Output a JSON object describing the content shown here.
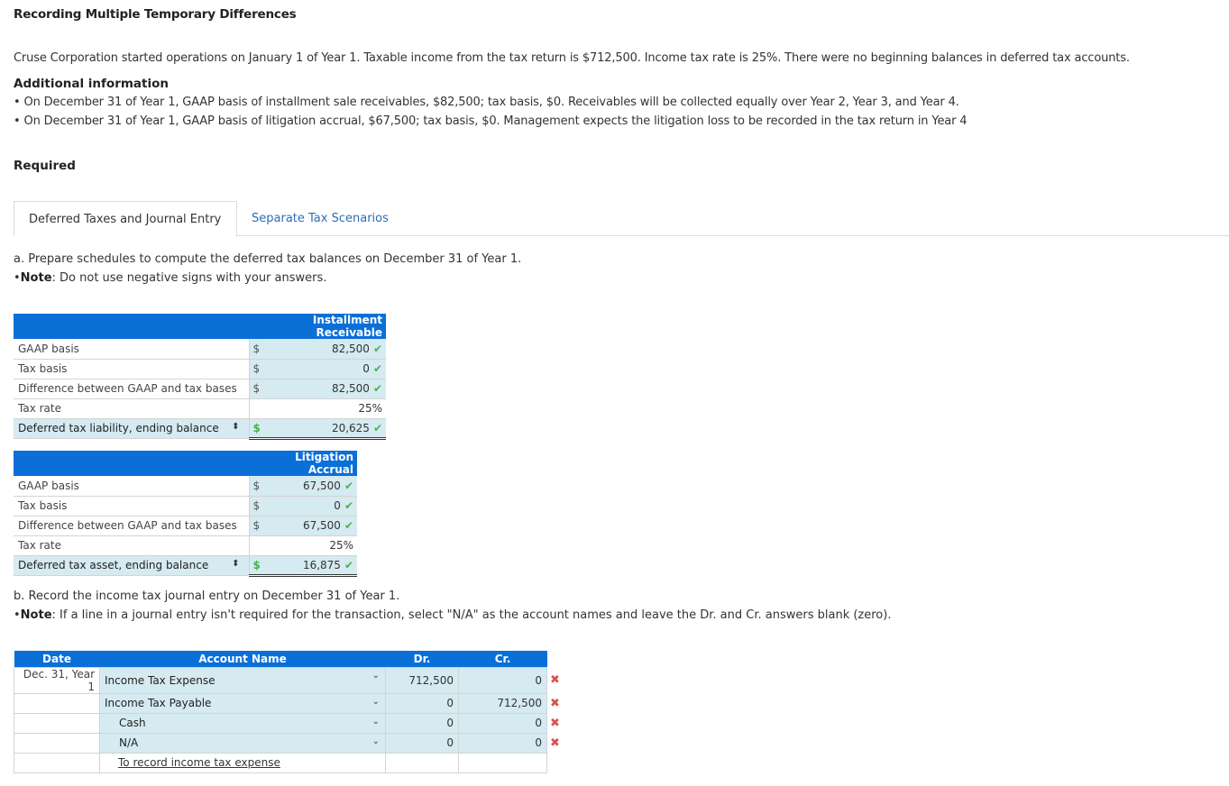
{
  "title": "Recording Multiple Temporary Differences",
  "intro": "Cruse Corporation started operations on January 1 of Year 1. Taxable income from the tax return is $712,500. Income tax rate is 25%. There were no beginning balances in deferred tax accounts.",
  "additional_info": {
    "heading": "Additional information",
    "bullets": [
      "• On December 31 of Year 1, GAAP basis of installment sale receivables, $82,500; tax basis, $0. Receivables will be collected equally over Year 2, Year 3, and Year 4.",
      "• On December 31 of Year 1, GAAP basis of litigation accrual, $67,500; tax basis, $0. Management expects the litigation loss to be recorded in the tax return in Year 4"
    ]
  },
  "required": "Required",
  "tabs": [
    {
      "label": "Deferred Taxes and Journal Entry",
      "active": true
    },
    {
      "label": "Separate Tax Scenarios",
      "active": false
    }
  ],
  "part_a": {
    "instruction": "a. Prepare schedules to compute the deferred tax balances on December 31 of Year 1.",
    "note_label": "Note",
    "note_text": ": Do not use negative signs with your answers."
  },
  "schedule_installment": {
    "header": "Installment Receivable",
    "rows": [
      {
        "label": "GAAP basis",
        "currency": "$",
        "value": "82,500",
        "status": "correct"
      },
      {
        "label": "Tax basis",
        "currency": "$",
        "value": "0",
        "status": "correct"
      },
      {
        "label": "Difference between GAAP and tax bases",
        "currency": "$",
        "value": "82,500",
        "status": "correct"
      },
      {
        "label": "Tax rate",
        "currency": "",
        "value": "25%",
        "status": ""
      },
      {
        "label": "Deferred tax liability, ending balance",
        "currency": "$",
        "value": "20,625",
        "status": "correct"
      }
    ]
  },
  "schedule_litigation": {
    "header": "Litigation Accrual",
    "rows": [
      {
        "label": "GAAP basis",
        "currency": "$",
        "value": "67,500",
        "status": "correct"
      },
      {
        "label": "Tax basis",
        "currency": "$",
        "value": "0",
        "status": "correct"
      },
      {
        "label": "Difference between GAAP and tax bases",
        "currency": "$",
        "value": "67,500",
        "status": "correct"
      },
      {
        "label": "Tax rate",
        "currency": "",
        "value": "25%",
        "status": ""
      },
      {
        "label": "Deferred tax asset, ending balance",
        "currency": "$",
        "value": "16,875",
        "status": "correct"
      }
    ]
  },
  "part_b": {
    "instruction": "b. Record the income tax journal entry on December 31 of Year 1.",
    "note_label": "Note",
    "note_text": ": If a line in a journal entry isn't required for the transaction, select \"N/A\" as the account names and leave the Dr. and Cr. answers blank (zero)."
  },
  "journal": {
    "headers": {
      "date": "Date",
      "account": "Account Name",
      "dr": "Dr.",
      "cr": "Cr."
    },
    "rows": [
      {
        "date": "Dec. 31, Year 1",
        "account": "Income Tax Expense",
        "dr": "712,500",
        "cr": "0",
        "status": "incorrect"
      },
      {
        "date": "",
        "account": "Income Tax Payable",
        "dr": "0",
        "cr": "712,500",
        "status": "incorrect"
      },
      {
        "date": "",
        "account": "Cash",
        "dr": "0",
        "cr": "0",
        "status": "incorrect"
      },
      {
        "date": "",
        "account": "N/A",
        "dr": "0",
        "cr": "0",
        "status": "incorrect"
      }
    ],
    "memo": "To record income tax expense"
  },
  "icons": {
    "check": "✔",
    "x": "✖",
    "caret": "⌄",
    "updown": "⬍"
  },
  "colors": {
    "header_blue": "#0b6fd8",
    "input_bg": "#d5eaf1",
    "correct_green": "#4caf50",
    "incorrect_red": "#d9534f",
    "tab_link": "#2a6ebb"
  }
}
